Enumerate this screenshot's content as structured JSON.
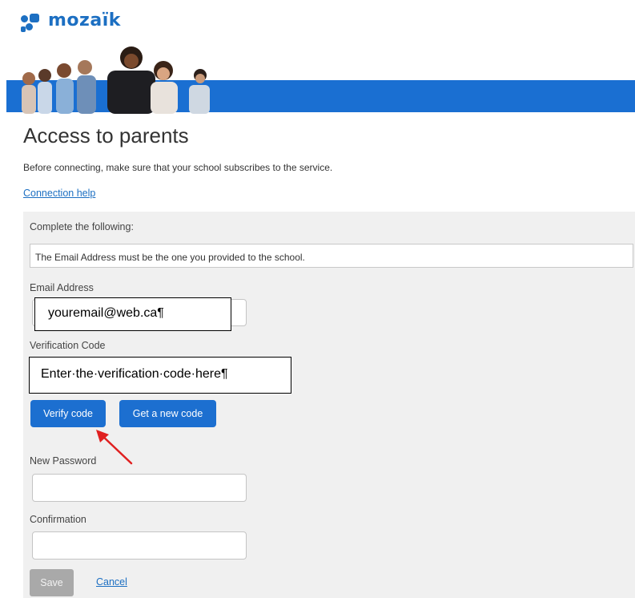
{
  "brand": {
    "name": "mozaïk",
    "color": "#1c6fc2"
  },
  "page": {
    "title": "Access to parents",
    "subtitle": "Before connecting, make sure that your school subscribes to the service.",
    "help_link": "Connection help"
  },
  "form": {
    "instructions": "Complete the following:",
    "info": "The Email Address must be the one you provided to the school.",
    "email_label": "Email Address",
    "email_overlay": "youremail@web.ca¶",
    "code_label": "Verification Code",
    "code_overlay": "Enter·the·verification·code·here¶",
    "verify_button": "Verify code",
    "new_code_button": "Get a new code",
    "new_password_label": "New Password",
    "confirmation_label": "Confirmation",
    "save_button": "Save",
    "cancel_link": "Cancel"
  },
  "colors": {
    "accent": "#1c6fd0",
    "banner": "#1a6fd2",
    "annotation_arrow": "#e02020"
  }
}
